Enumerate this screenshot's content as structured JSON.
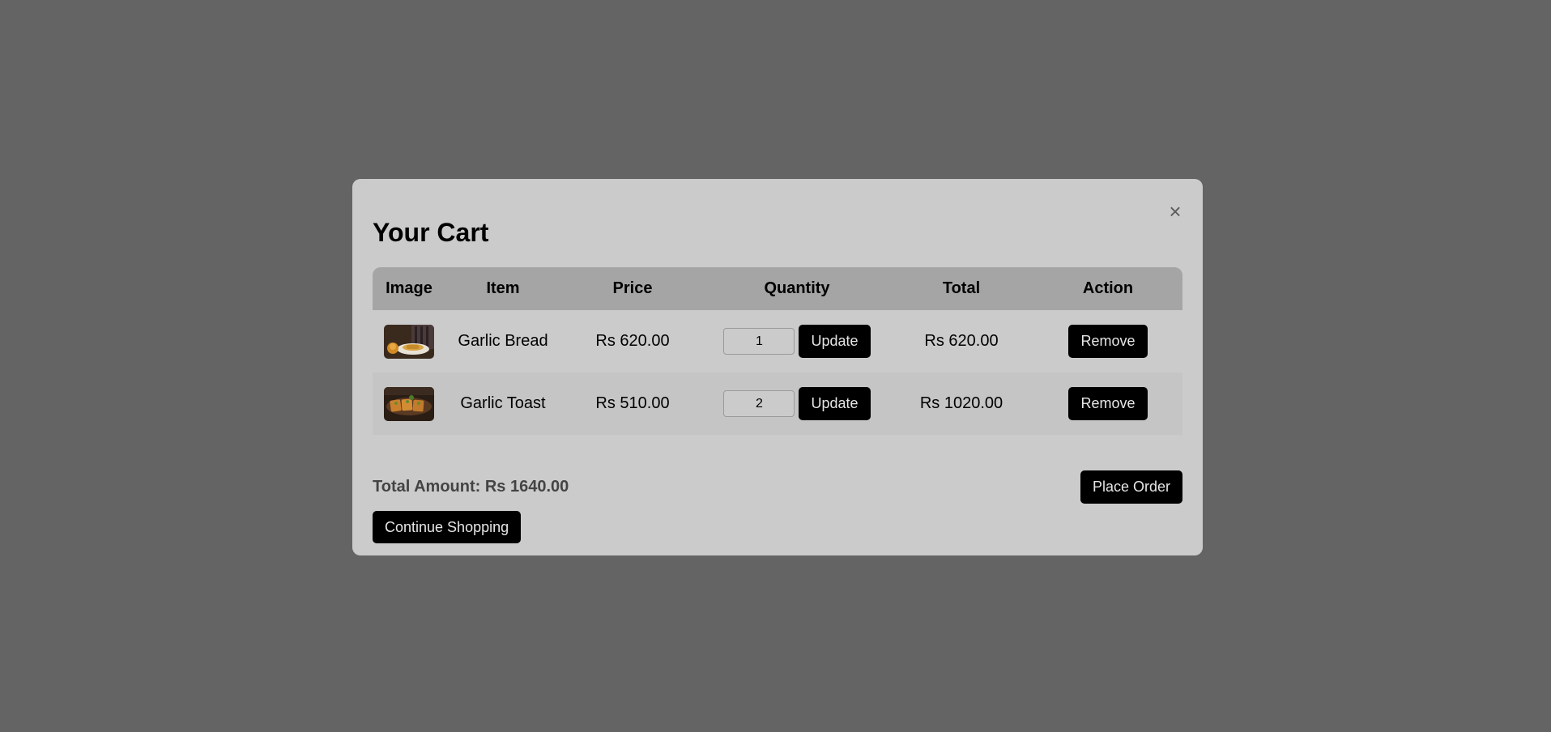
{
  "modal": {
    "title": "Your Cart",
    "close_glyph": "×"
  },
  "table": {
    "headers": [
      "Image",
      "Item",
      "Price",
      "Quantity",
      "Total",
      "Action"
    ],
    "rows": [
      {
        "item": "Garlic Bread",
        "price": "Rs 620.00",
        "quantity": "1",
        "total": "Rs 620.00",
        "update_label": "Update",
        "remove_label": "Remove",
        "image_icon": "garlic-bread-photo"
      },
      {
        "item": "Garlic Toast",
        "price": "Rs 510.00",
        "quantity": "2",
        "total": "Rs 1020.00",
        "update_label": "Update",
        "remove_label": "Remove",
        "image_icon": "garlic-toast-photo"
      }
    ]
  },
  "footer": {
    "total_amount": "Total Amount: Rs 1640.00",
    "place_order_label": "Place Order",
    "continue_label": "Continue Shopping"
  },
  "colors": {
    "overlay": "#636463",
    "modal_bg": "#cbcbcb",
    "header_bg": "#a5a5a5",
    "button_bg": "#000000"
  }
}
